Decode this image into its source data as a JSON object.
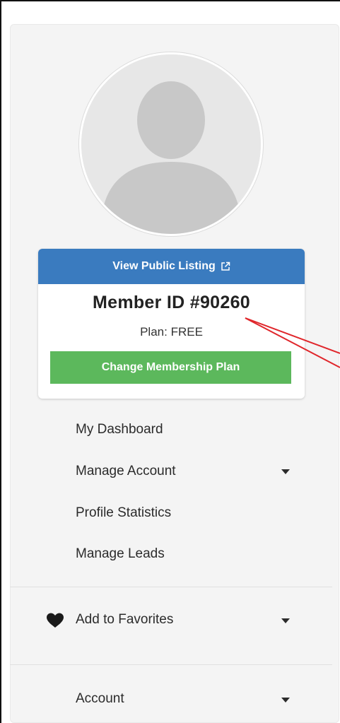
{
  "profile": {
    "view_listing_label": "View Public Listing",
    "member_id": "Member ID #90260",
    "plan": "Plan: FREE",
    "change_plan_label": "Change Membership Plan"
  },
  "menu": {
    "dashboard": "My Dashboard",
    "manage_account": "Manage Account",
    "profile_statistics": "Profile Statistics",
    "manage_leads": "Manage Leads"
  },
  "favorites": {
    "label": "Add to Favorites"
  },
  "account": {
    "label": "Account"
  },
  "colors": {
    "listing_button": "#3a7bbf",
    "change_button": "#5cb85c",
    "annotation": "#e0262b"
  },
  "icons": {
    "external_link": "external-link-icon",
    "heart": "heart-icon",
    "caret": "caret-down-icon",
    "avatar": "user-silhouette-icon"
  }
}
